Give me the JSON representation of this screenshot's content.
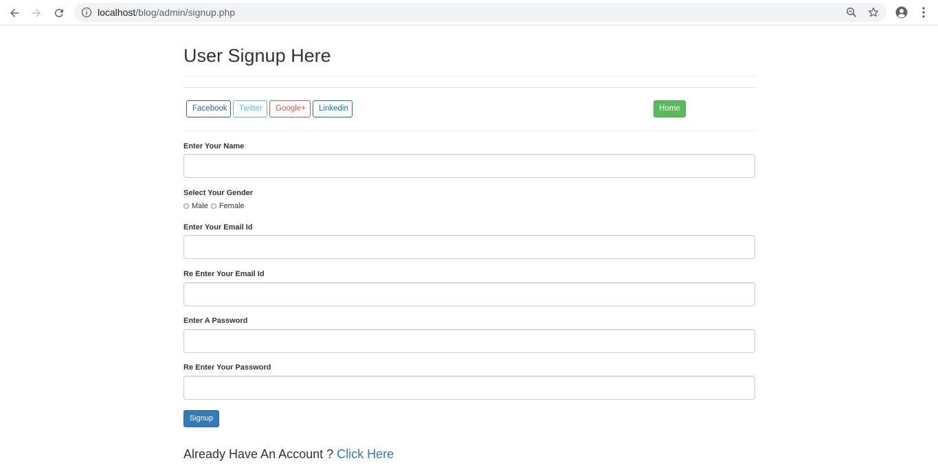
{
  "browser": {
    "url_host": "localhost",
    "url_path": "/blog/admin/signup.php"
  },
  "page": {
    "title": "User Signup Here"
  },
  "social": {
    "facebook": "Facebook",
    "twitter": "Twitter",
    "google": "Google+",
    "linkedin": "Linkedin",
    "home": "Home"
  },
  "form": {
    "name_label": "Enter Your Name",
    "gender_label": "Select Your Gender",
    "gender_male": "Male",
    "gender_female": "Female",
    "email_label": "Enter Your Email Id",
    "email_confirm_label": "Re Enter Your Email Id",
    "password_label": "Enter A Password",
    "password_confirm_label": "Re Enter Your Password",
    "submit_label": "Signup"
  },
  "footer": {
    "prompt": "Already Have An Account ?",
    "link": "Click Here"
  },
  "colors": {
    "facebook": "#3b5998",
    "twitter": "#5bc0de",
    "google": "#d9534f",
    "linkedin": "#0e76a8",
    "home": "#5cb85c",
    "primary": "#337ab7"
  }
}
